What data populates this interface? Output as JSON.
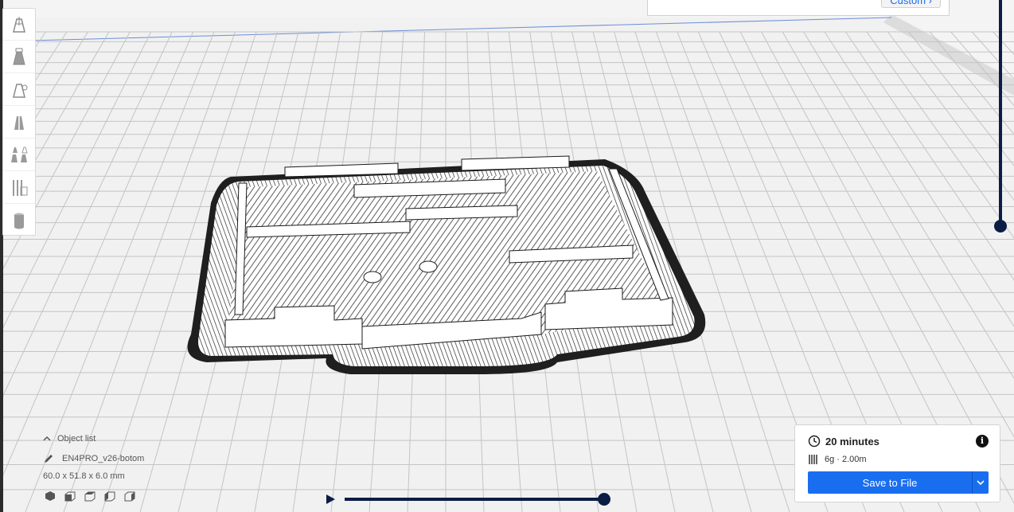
{
  "top_panel": {
    "custom_label": "Custom ›"
  },
  "toolbar": {
    "tools": [
      {
        "name": "move-tool",
        "icon": "move-icon"
      },
      {
        "name": "scale-tool",
        "icon": "scale-icon"
      },
      {
        "name": "rotate-tool",
        "icon": "rotate-icon"
      },
      {
        "name": "mirror-tool",
        "icon": "mirror-icon"
      },
      {
        "name": "per-model-settings-tool",
        "icon": "per-model-icon"
      },
      {
        "name": "support-blocker-tool",
        "icon": "support-blocker-icon"
      },
      {
        "name": "cylinder-tool",
        "icon": "cylinder-icon"
      }
    ]
  },
  "object": {
    "list_label": "Object list",
    "name": "EN4PRO_v26-botom",
    "dimensions": "60.0 x 51.8 x 6.0 mm"
  },
  "print_info": {
    "time": "20 minutes",
    "material": "6g · 2.00m",
    "save_label": "Save to File",
    "info_glyph": "i"
  },
  "colors": {
    "accent": "#196ef0",
    "slider": "#0b1d44"
  }
}
